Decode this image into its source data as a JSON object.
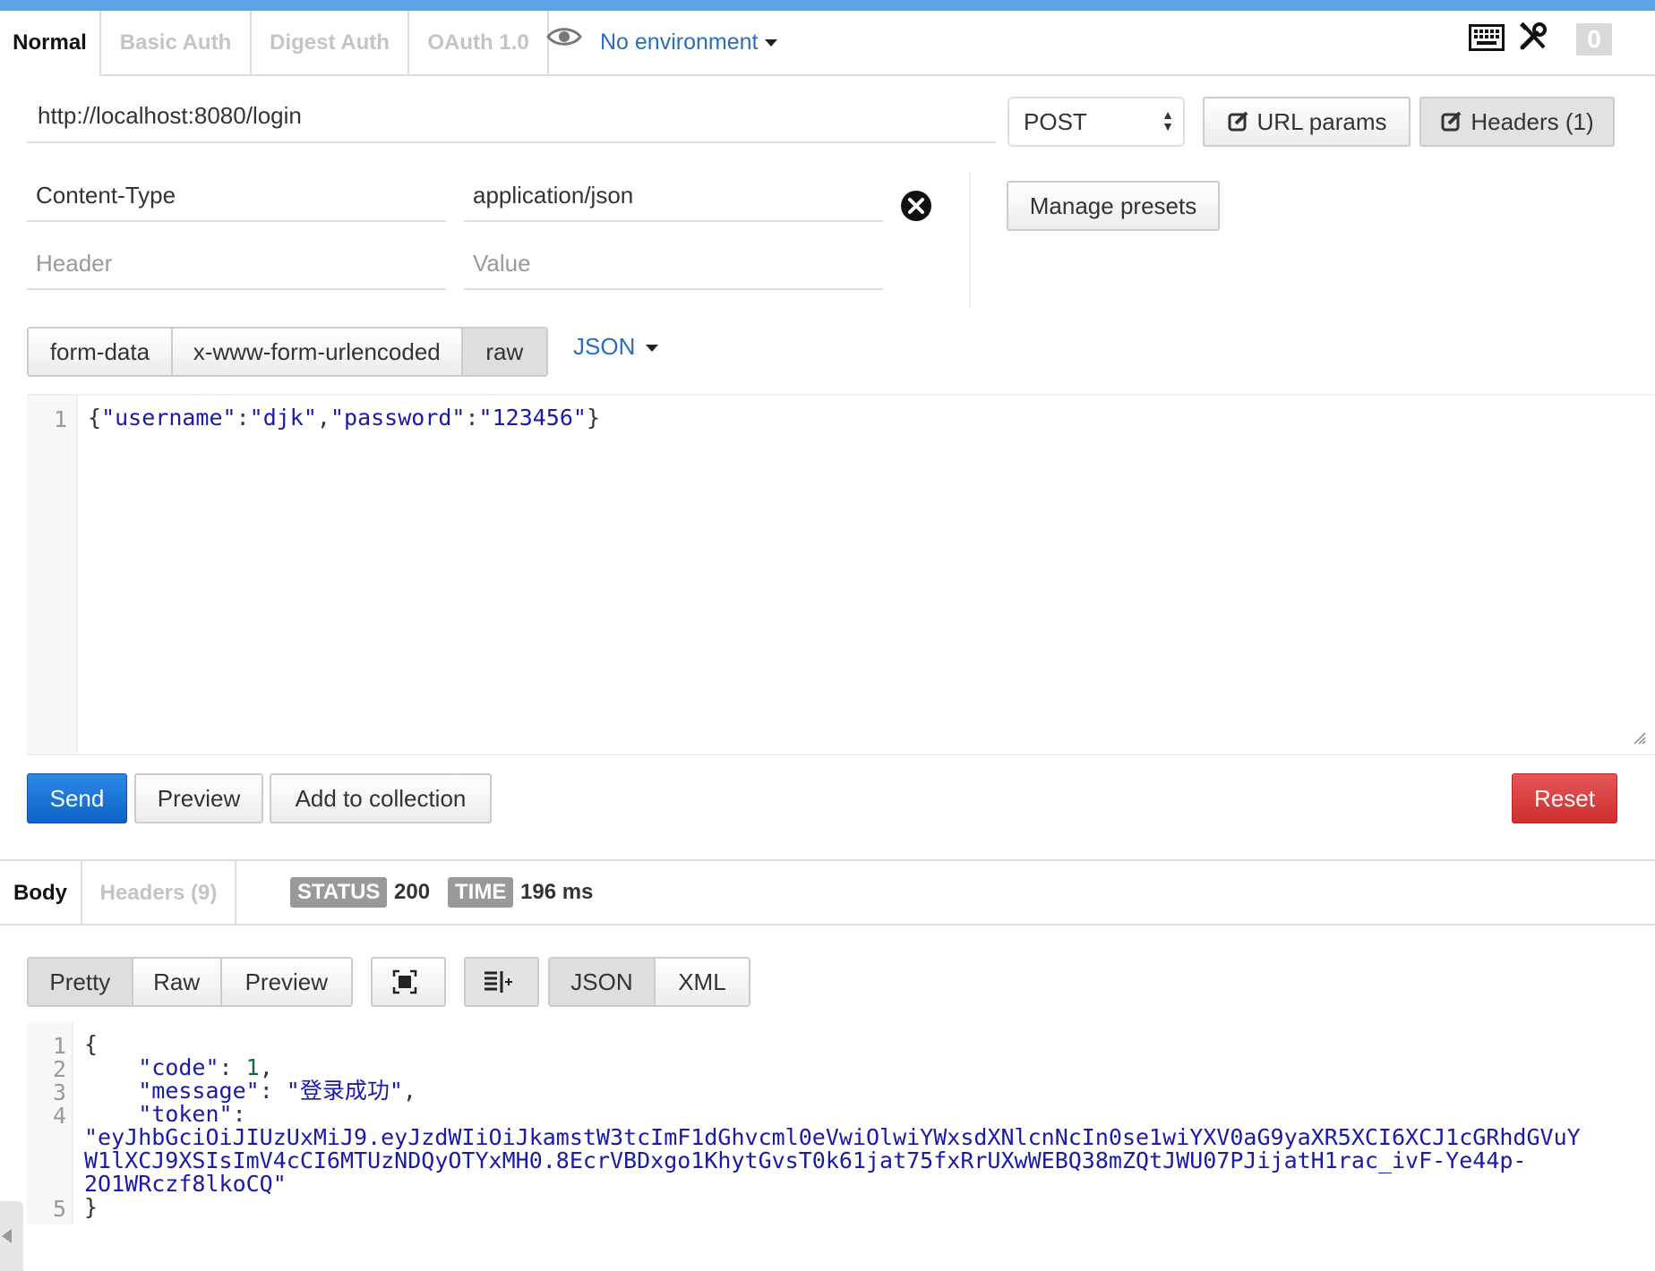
{
  "tabs": [
    {
      "label": "Normal"
    },
    {
      "label": "Basic Auth"
    },
    {
      "label": "Digest Auth"
    },
    {
      "label": "OAuth 1.0"
    }
  ],
  "environment": {
    "label": "No environment"
  },
  "counter": "0",
  "request": {
    "url": "http://localhost:8080/login",
    "method": "POST",
    "url_params_label": "URL params",
    "headers_label": "Headers (1)"
  },
  "headers": {
    "rows": [
      {
        "key": "Content-Type",
        "value": "application/json"
      }
    ],
    "key_placeholder": "Header",
    "value_placeholder": "Value",
    "manage_presets": "Manage presets"
  },
  "body_types": [
    "form-data",
    "x-www-form-urlencoded",
    "raw"
  ],
  "body_format": "JSON",
  "request_body": {
    "line_number": "1",
    "tokens": [
      "{",
      "\"username\"",
      ":",
      "\"djk\"",
      ",",
      "\"password\"",
      ":",
      "\"123456\"",
      "}"
    ]
  },
  "actions": {
    "send": "Send",
    "preview": "Preview",
    "add_to_collection": "Add to collection",
    "reset": "Reset"
  },
  "response": {
    "tabs": [
      {
        "label": "Body"
      },
      {
        "label": "Headers (9)"
      }
    ],
    "status_label": "STATUS",
    "status_value": "200",
    "time_label": "TIME",
    "time_value": "196 ms",
    "view_modes": [
      "Pretty",
      "Raw",
      "Preview"
    ],
    "formats": [
      "JSON",
      "XML"
    ],
    "line_numbers": [
      "1",
      "2",
      "3",
      "4",
      "5"
    ],
    "body": {
      "open": "{",
      "code_key": "\"code\"",
      "code_value": "1",
      "message_key": "\"message\"",
      "message_value": "\"登录成功\"",
      "token_key": "\"token\"",
      "token_line1": "\"eyJhbGciOiJIUzUxMiJ9.eyJzdWIiOiJkamstW3tcImF1dGhvcml0eVwiOlwiYWxsdXNlcnNcIn0se1wiYXV0aG9yaXR5XCI6XCJ1cGRhdGVuY",
      "token_line2": "W1lXCJ9XSIsImV4cCI6MTUzNDQyOTYxMH0.8EcrVBDxgo1KhytGvsT0k61jat75fxRrUXwWEBQ38mZQtJWU07PJijatH1rac_ivF-Ye44p-",
      "token_line3": "2O1WRczf8lkoCQ\"",
      "close": "}"
    }
  },
  "colors": {
    "accent": "#5ba4e6",
    "link": "#2a6ebb",
    "send": "#1a73d6",
    "reset": "#d93a3a",
    "string": "#1a1aa6",
    "number": "#116644"
  }
}
